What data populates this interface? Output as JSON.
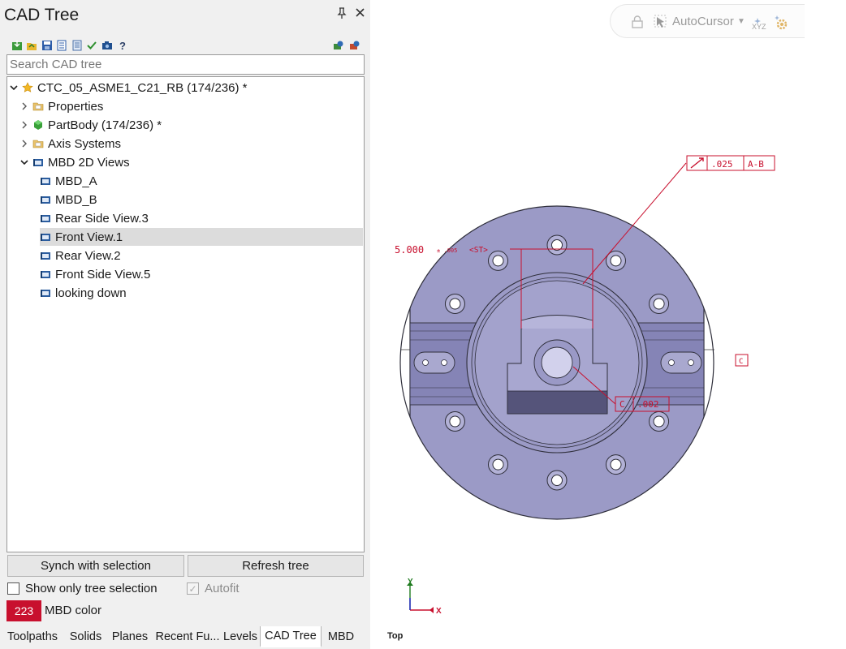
{
  "panel": {
    "title": "CAD Tree",
    "pin_icon": "pin-icon",
    "close_icon": "close-icon",
    "toolbar_icons": [
      "import-icon",
      "open-folder-icon",
      "save-icon",
      "document-icon",
      "list-icon",
      "checkmark-icon",
      "camera-icon",
      "help-icon",
      "filter-toggle-icon",
      "settings-icon"
    ],
    "search": {
      "placeholder": "Search CAD tree",
      "value": ""
    }
  },
  "tree": {
    "root": {
      "label": "CTC_05_ASME1_C21_RB (174/236) *",
      "icon": "star-icon",
      "expanded": true
    },
    "children": [
      {
        "label": "Properties",
        "icon": "folder-icon",
        "expanded": false
      },
      {
        "label": "PartBody (174/236) *",
        "icon": "green-solid-icon",
        "expanded": false
      },
      {
        "label": "Axis Systems",
        "icon": "folder-icon",
        "expanded": false
      },
      {
        "label": "MBD 2D Views",
        "icon": "view-icon",
        "expanded": true
      }
    ],
    "views": [
      {
        "label": "MBD_A",
        "selected": false
      },
      {
        "label": "MBD_B",
        "selected": false
      },
      {
        "label": "Rear Side View.3",
        "selected": false
      },
      {
        "label": "Front View.1",
        "selected": true
      },
      {
        "label": "Rear View.2",
        "selected": false
      },
      {
        "label": "Front Side View.5",
        "selected": false
      },
      {
        "label": "looking down",
        "selected": false
      }
    ]
  },
  "buttons": {
    "synch": "Synch with selection",
    "refresh": "Refresh tree"
  },
  "options": {
    "show_only_tree_selection": {
      "label": "Show only tree selection",
      "checked": false
    },
    "autofit": {
      "label": "Autofit",
      "checked": true,
      "disabled": true
    },
    "mbd_color": {
      "value": "223",
      "label": "MBD color",
      "color": "#c8102e"
    }
  },
  "tabs": [
    {
      "label": "Toolpaths",
      "active": false
    },
    {
      "label": "Solids",
      "active": false
    },
    {
      "label": "Planes",
      "active": false
    },
    {
      "label": "Recent Fu...",
      "active": false
    },
    {
      "label": "Levels",
      "active": false
    },
    {
      "label": "CAD Tree",
      "active": true
    },
    {
      "label": "MBD",
      "active": false
    }
  ],
  "viewport": {
    "autocursor": {
      "label": "AutoCursor",
      "icons": [
        "lock-icon",
        "cursor-icon",
        "caret-icon",
        "xyz-icon",
        "gear-icon"
      ]
    },
    "annotations": {
      "dim_value": "5.000",
      "dim_tolerance": "± .005",
      "dim_note": "<ST>",
      "runout_tolerance": ".025",
      "runout_datum": "A-B",
      "datum_c": "C",
      "fcf2_prefix": "C",
      "fcf2_value": ".002"
    },
    "colors": {
      "part_fill": "#9b9ac6",
      "part_edge": "#2e2e3a",
      "mbd": "#c8102e",
      "triad": "#c8102e"
    },
    "triad": {
      "x_label": "X",
      "y_label": "Y"
    },
    "view_name": "Top"
  }
}
